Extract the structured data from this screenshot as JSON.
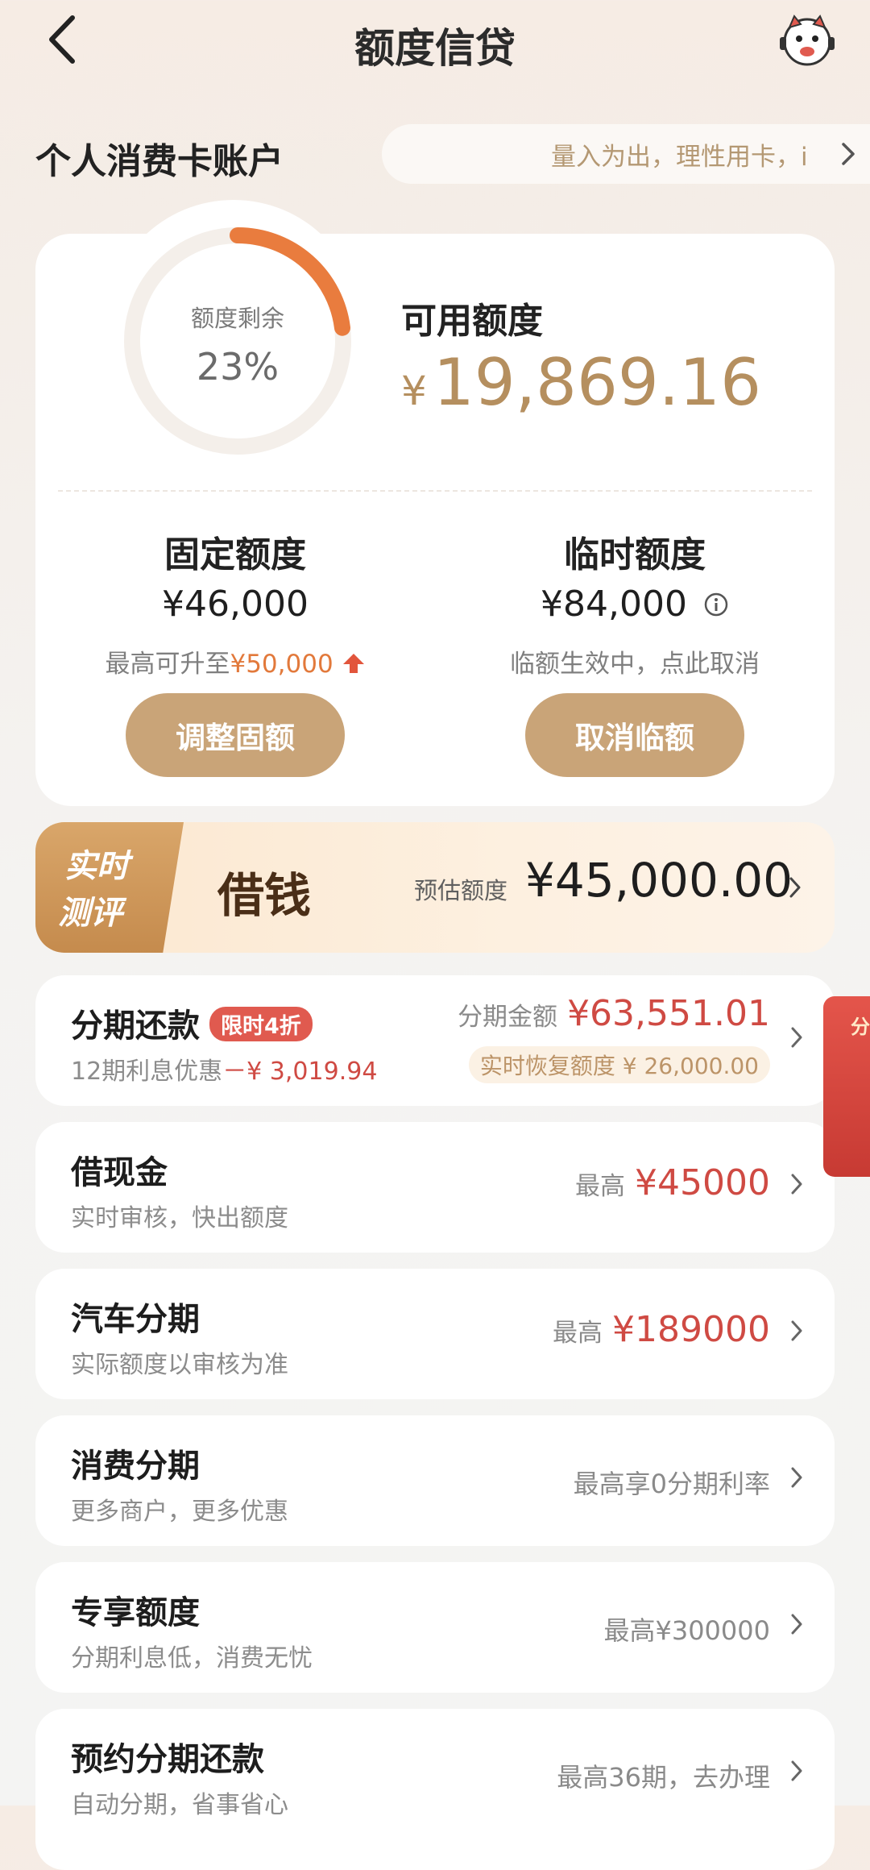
{
  "header": {
    "title": "额度信贷",
    "back_icon": "back-arrow-icon",
    "mascot_icon": "mascot-avatar-icon"
  },
  "account": {
    "title": "个人消费卡账户",
    "slogan": "量入为出，理性用卡，i"
  },
  "credit": {
    "ring_label": "额度剩余",
    "remaining_percent_text": "23%",
    "remaining_fraction": 0.23,
    "available_label": "可用额度",
    "available_currency": "¥",
    "available_value": "19,869.16",
    "fixed": {
      "label": "固定额度",
      "value": "¥46,000",
      "note_prefix": "最高可升至",
      "note_value": "¥50,000",
      "button": "调整固额"
    },
    "temp": {
      "label": "临时额度",
      "value": "¥84,000",
      "note": "临额生效中，点此取消",
      "button": "取消临额"
    }
  },
  "borrow": {
    "tag_line1": "实时",
    "tag_line2": "测评",
    "title": "借钱",
    "est_label": "预估额度",
    "est_amount": "¥45,000.00"
  },
  "items": [
    {
      "name": "分期还款",
      "tag": "限时4折",
      "sub_prefix": "12期利息优惠",
      "sub_value": "－¥ 3,019.94",
      "pre": "分期金额",
      "val": "¥63,551.01",
      "pill": "实时恢复额度 ¥ 26,000.00"
    },
    {
      "name": "借现金",
      "sub": "实时审核，快出额度",
      "pre": "最高",
      "val": "¥45000"
    },
    {
      "name": "汽车分期",
      "sub": "实际额度以审核为准",
      "pre": "最高",
      "val": "¥189000"
    },
    {
      "name": "消费分期",
      "sub": "更多商户，更多优惠",
      "plain": "最高享0分期利率"
    },
    {
      "name": "专享额度",
      "sub": "分期利息低，消费无忧",
      "plain": "最高¥300000"
    },
    {
      "name": "预约分期还款",
      "sub": "自动分期，省事省心",
      "plain": "最高36期，去办理"
    }
  ],
  "side_badge": {
    "text": "分"
  },
  "colors": {
    "accent_gold": "#c9a478",
    "accent_orange": "#e2793b",
    "accent_red": "#cf4a43"
  }
}
